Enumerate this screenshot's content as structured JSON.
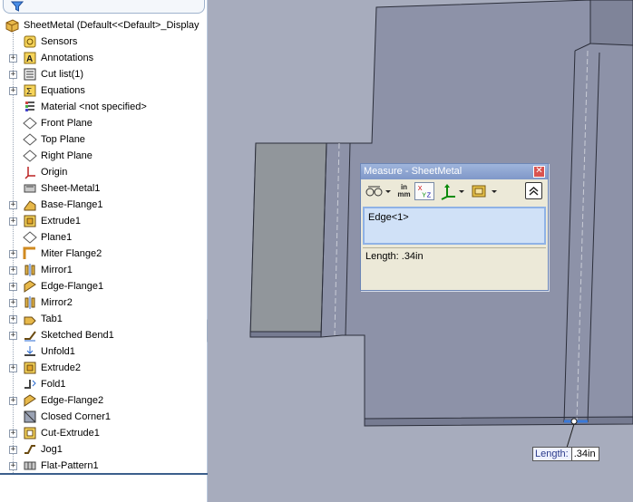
{
  "tree": {
    "root_label": "SheetMetal  (Default<<Default>_Display",
    "items": [
      {
        "label": "Sensors",
        "expandable": false,
        "icon": "sensors-icon"
      },
      {
        "label": "Annotations",
        "expandable": true,
        "icon": "annotations-icon"
      },
      {
        "label": "Cut list(1)",
        "expandable": true,
        "icon": "cut-list-icon"
      },
      {
        "label": "Equations",
        "expandable": true,
        "icon": "equations-icon"
      },
      {
        "label": "Material <not specified>",
        "expandable": false,
        "icon": "material-icon"
      },
      {
        "label": "Front Plane",
        "expandable": false,
        "icon": "plane-icon"
      },
      {
        "label": "Top Plane",
        "expandable": false,
        "icon": "plane-icon"
      },
      {
        "label": "Right Plane",
        "expandable": false,
        "icon": "plane-icon"
      },
      {
        "label": "Origin",
        "expandable": false,
        "icon": "origin-icon"
      },
      {
        "label": "Sheet-Metal1",
        "expandable": false,
        "icon": "sheet-metal-icon"
      },
      {
        "label": "Base-Flange1",
        "expandable": true,
        "icon": "base-flange-icon"
      },
      {
        "label": "Extrude1",
        "expandable": true,
        "icon": "extrude-icon"
      },
      {
        "label": "Plane1",
        "expandable": false,
        "icon": "plane-icon"
      },
      {
        "label": "Miter Flange2",
        "expandable": true,
        "icon": "miter-flange-icon"
      },
      {
        "label": "Mirror1",
        "expandable": true,
        "icon": "mirror-icon"
      },
      {
        "label": "Edge-Flange1",
        "expandable": true,
        "icon": "edge-flange-icon"
      },
      {
        "label": "Mirror2",
        "expandable": true,
        "icon": "mirror-icon"
      },
      {
        "label": "Tab1",
        "expandable": true,
        "icon": "tab-icon"
      },
      {
        "label": "Sketched Bend1",
        "expandable": true,
        "icon": "sketched-bend-icon"
      },
      {
        "label": "Unfold1",
        "expandable": false,
        "icon": "unfold-icon"
      },
      {
        "label": "Extrude2",
        "expandable": true,
        "icon": "extrude-icon"
      },
      {
        "label": "Fold1",
        "expandable": false,
        "icon": "fold-icon"
      },
      {
        "label": "Edge-Flange2",
        "expandable": true,
        "icon": "edge-flange-icon"
      },
      {
        "label": "Closed Corner1",
        "expandable": false,
        "icon": "closed-corner-icon"
      },
      {
        "label": "Cut-Extrude1",
        "expandable": true,
        "icon": "cut-extrude-icon"
      },
      {
        "label": "Jog1",
        "expandable": true,
        "icon": "jog-icon"
      },
      {
        "label": "Flat-Pattern1",
        "expandable": true,
        "icon": "flat-pattern-icon"
      }
    ]
  },
  "measure": {
    "title": "Measure - SheetMetal",
    "units_top": "in",
    "units_bottom": "mm",
    "xyz_label": "XYZ",
    "selection": "Edge<1>",
    "result": "Length: .34in"
  },
  "callout": {
    "name": "Length:",
    "value": ".34in"
  },
  "colors": {
    "viewport_bg": "#a7acbd",
    "part_face": "#8a8fa5",
    "part_light": "#9da2b6",
    "edge": "#2b2e3a",
    "selected_edge": "#3a79d8"
  }
}
